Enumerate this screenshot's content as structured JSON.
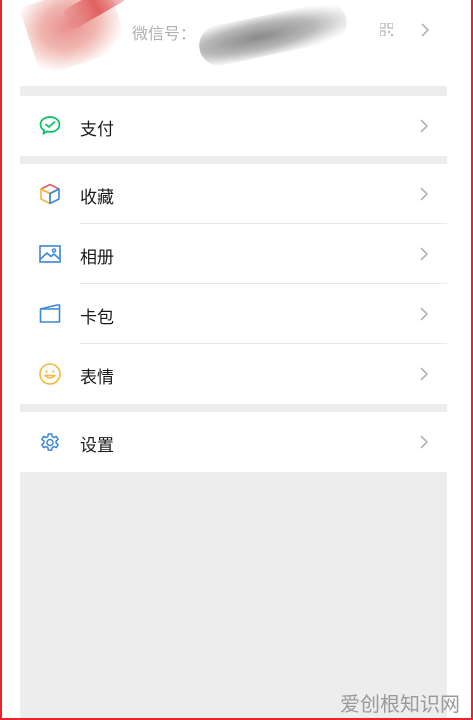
{
  "profile": {
    "wechat_id_label": "微信号："
  },
  "menu": {
    "pay": {
      "label": "支付",
      "icon": "wechat-pay-icon"
    },
    "favorites": {
      "label": "收藏",
      "icon": "cube-icon"
    },
    "album": {
      "label": "相册",
      "icon": "image-icon"
    },
    "card": {
      "label": "卡包",
      "icon": "card-wallet-icon"
    },
    "sticker": {
      "label": "表情",
      "icon": "smiley-icon"
    },
    "settings": {
      "label": "设置",
      "icon": "gear-icon"
    }
  },
  "watermark": "爱创根知识网",
  "colors": {
    "accent_green": "#07c160",
    "icon_blue": "#3b87d8",
    "frame_red": "#e8242c",
    "smiley_yellow": "#f1b83d"
  }
}
